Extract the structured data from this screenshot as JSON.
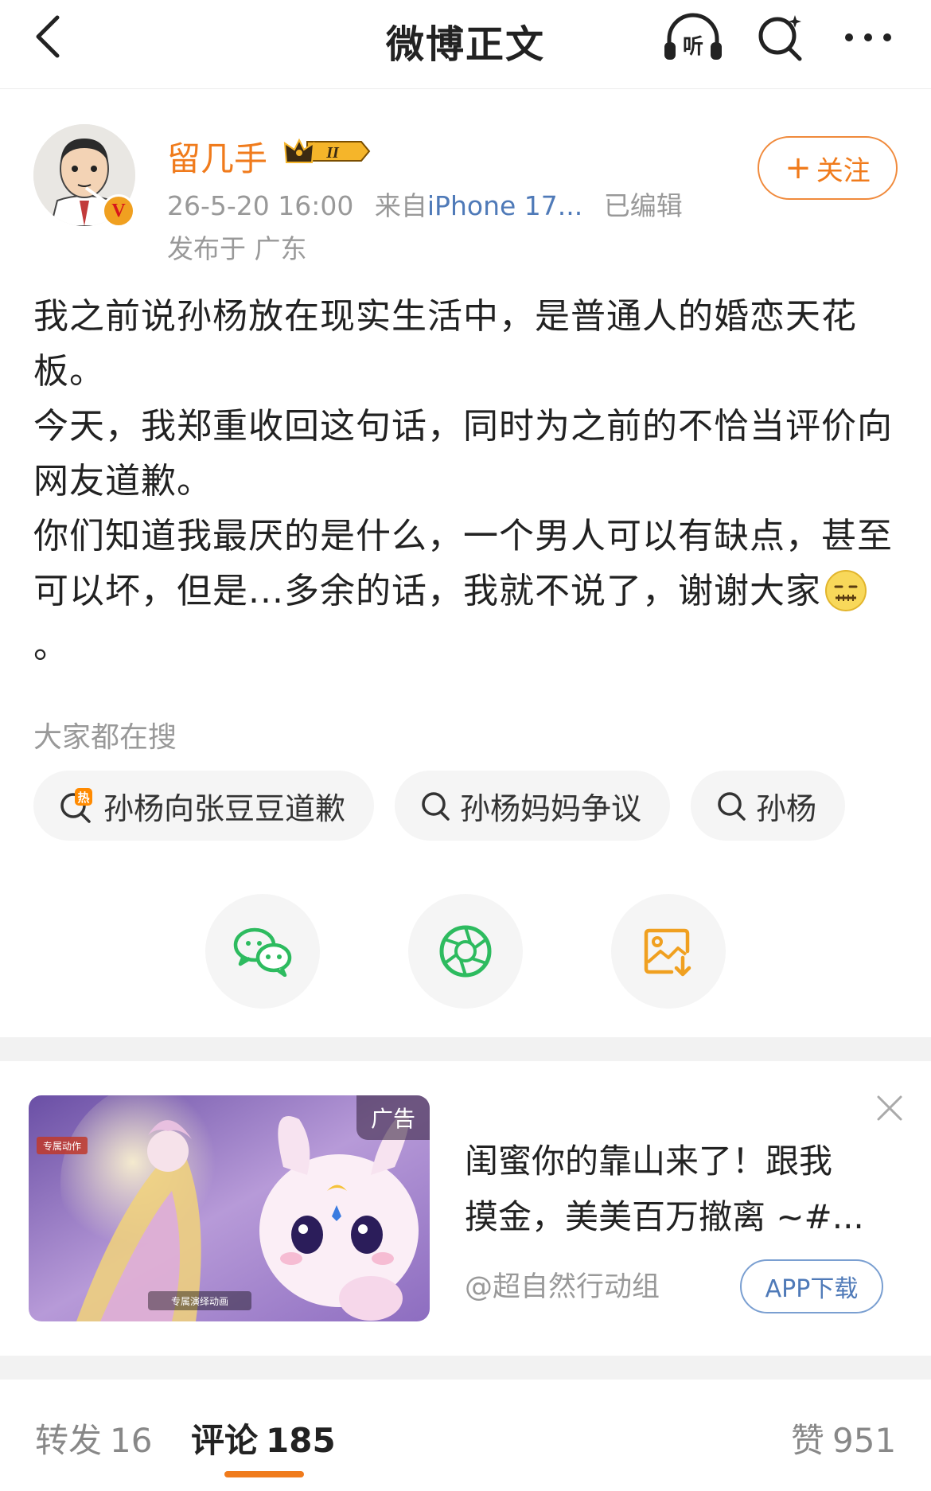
{
  "nav": {
    "title": "微博正文",
    "listen_label": "听"
  },
  "post": {
    "author": "留几手",
    "verified_mark": "V",
    "vip_level": "II",
    "time": "26-5-20 16:00",
    "from_prefix": "来自",
    "device": "iPhone 17...",
    "edited": "已编辑",
    "location": "发布于 广东",
    "follow_label": "关注",
    "paragraphs": [
      "我之前说孙杨放在现实生活中，是普通人的婚恋天花板。",
      "今天，我郑重收回这句话，同时为之前的不恰当评价向网友道歉。",
      "你们知道我最厌的是什么，一个男人可以有缺点，甚至可以坏，但是...多余的话，我就不说了，谢谢大家"
    ],
    "ending_punct": "。",
    "emoji_name": "zipped-mouth-emoji"
  },
  "hot_search": {
    "title": "大家都在搜",
    "hot_badge": "热",
    "chips": [
      {
        "label": "孙杨向张豆豆道歉",
        "icon": "hot-search-icon"
      },
      {
        "label": "孙杨妈妈争议",
        "icon": "search-icon"
      },
      {
        "label": "孙杨",
        "icon": "search-icon"
      }
    ]
  },
  "share": {
    "items": [
      "wechat-icon",
      "moments-icon",
      "save-image-icon"
    ],
    "colors": {
      "wechat": "#2dbb5f",
      "moments": "#2dbb5f",
      "save": "#f0a020"
    }
  },
  "ad": {
    "tag": "广告",
    "headline_line1": "闺蜜你的靠山来了！跟我",
    "headline_line2": "摸金，美美百万撤离 ~#...",
    "source": "@超自然行动组",
    "download_label": "APP下载",
    "img_label_top": "专属动作",
    "img_label_bottom": "专属演绎动画"
  },
  "tabs": {
    "repost_label": "转发",
    "repost_count": "16",
    "comment_label": "评论",
    "comment_count": "185",
    "like_label": "赞",
    "like_count": "951"
  },
  "colors": {
    "accent": "#f07b1c",
    "link": "#4f7ab8",
    "muted": "#999999"
  }
}
